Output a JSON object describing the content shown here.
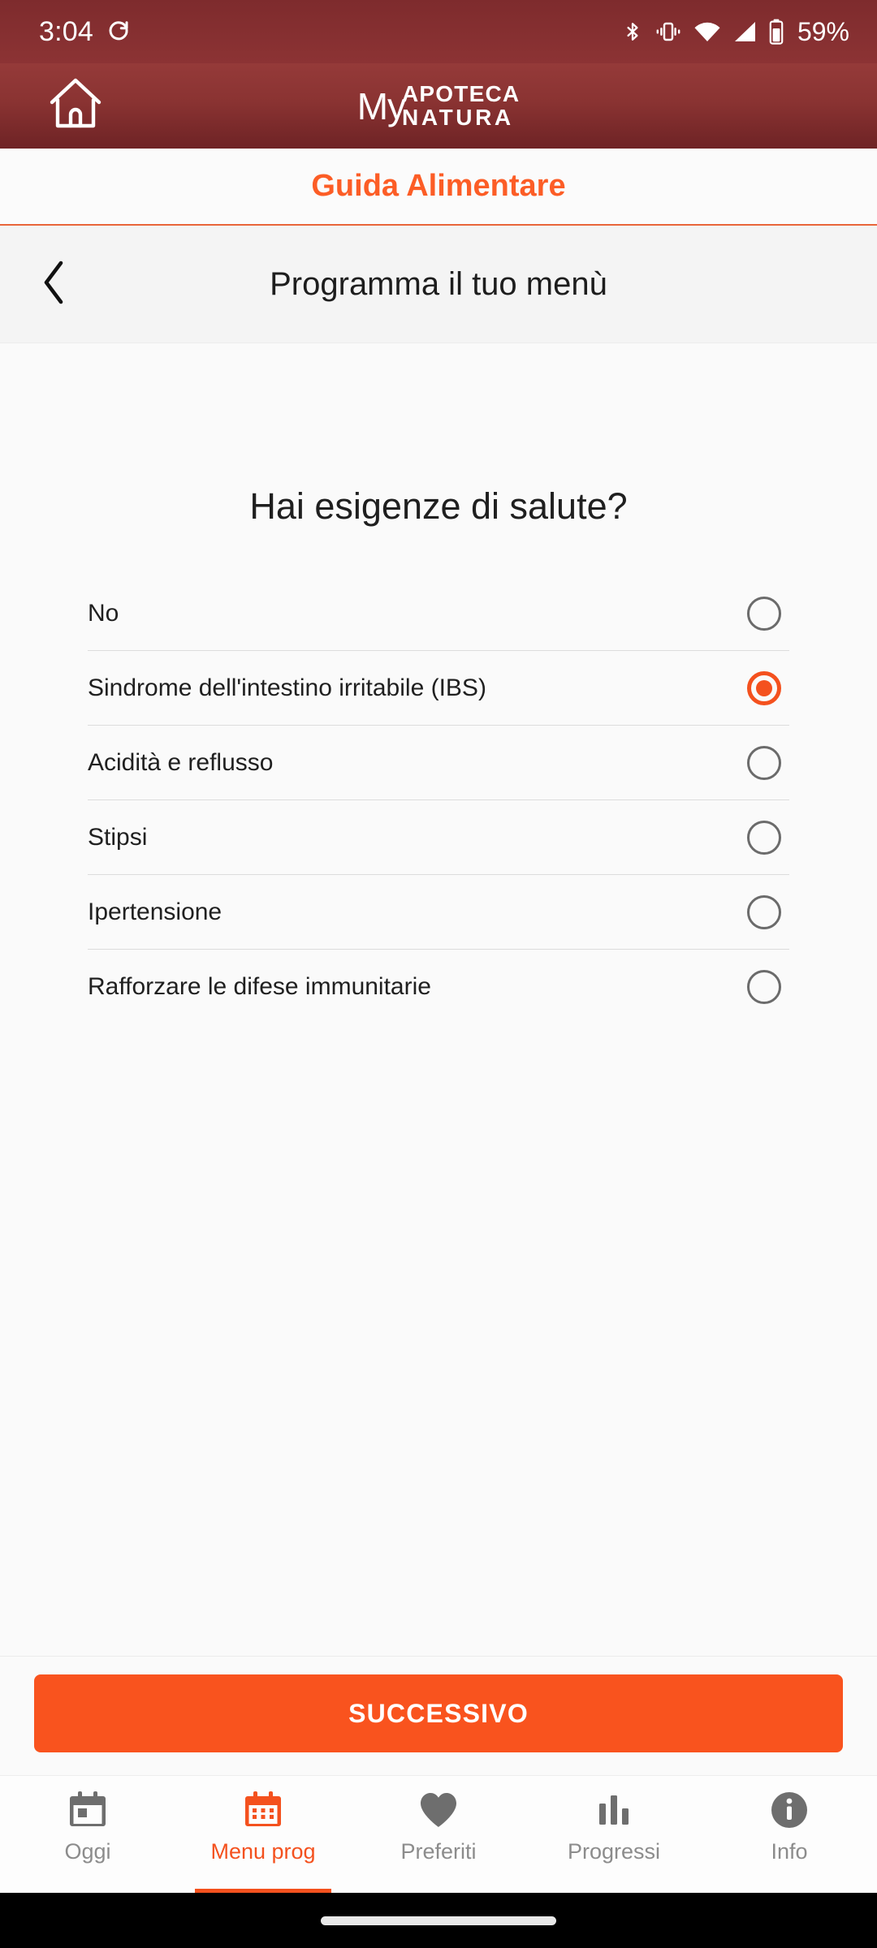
{
  "status_bar": {
    "time": "3:04",
    "battery_percent": "59%",
    "icons": [
      "sync-icon",
      "bluetooth-icon",
      "vibrate-icon",
      "wifi-icon",
      "cellular-signal-icon",
      "battery-icon"
    ]
  },
  "brand_header": {
    "home_icon": "home-icon",
    "logo_my": "My",
    "logo_line1": "APOTECA",
    "logo_line2": "NATURA"
  },
  "guide_band": {
    "title": "Guida Alimentare"
  },
  "page_header": {
    "back_icon": "chevron-left-icon",
    "title": "Programma il tuo menù"
  },
  "main": {
    "question": "Hai esigenze di salute?",
    "options": [
      {
        "label": "No",
        "selected": false
      },
      {
        "label": "Sindrome dell'intestino irritabile (IBS)",
        "selected": true
      },
      {
        "label": "Acidità e reflusso",
        "selected": false
      },
      {
        "label": "Stipsi",
        "selected": false
      },
      {
        "label": "Ipertensione",
        "selected": false
      },
      {
        "label": "Rafforzare le difese immunitarie",
        "selected": false
      }
    ]
  },
  "cta": {
    "label": "SUCCESSIVO"
  },
  "bottom_nav": {
    "items": [
      {
        "label": "Oggi",
        "icon": "calendar-today-icon",
        "active": false
      },
      {
        "label": "Menu prog",
        "icon": "calendar-grid-icon",
        "active": true
      },
      {
        "label": "Preferiti",
        "icon": "heart-icon",
        "active": false
      },
      {
        "label": "Progressi",
        "icon": "bar-chart-icon",
        "active": false
      },
      {
        "label": "Info",
        "icon": "info-circle-icon",
        "active": false
      }
    ]
  },
  "colors": {
    "brand_maroon": "#8a3332",
    "accent_orange": "#f4511e",
    "cta_orange": "#f9531e",
    "title_orange": "#fc5d26",
    "inactive_gray": "#8c8c8c"
  }
}
